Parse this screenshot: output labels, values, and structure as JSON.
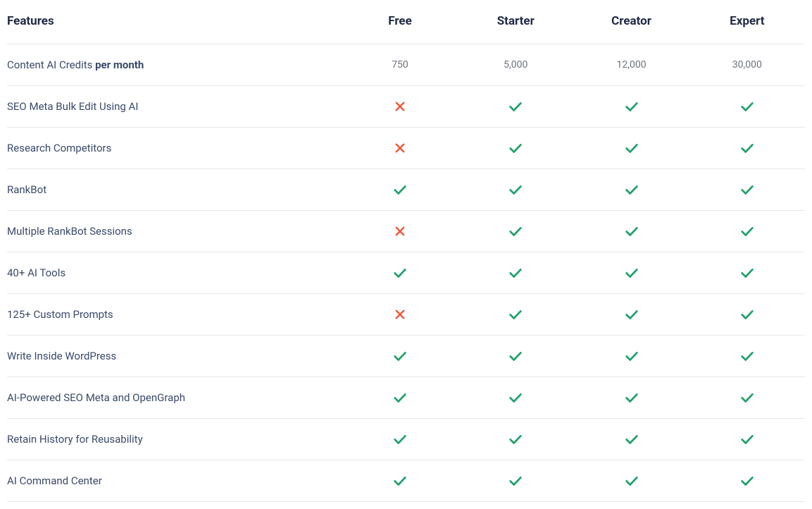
{
  "header": {
    "features_label": "Features",
    "plans": [
      "Free",
      "Starter",
      "Creator",
      "Expert"
    ]
  },
  "rows": [
    {
      "label": "Content AI Credits ",
      "label_bold": "per month",
      "type": "text",
      "values": [
        "750",
        "5,000",
        "12,000",
        "30,000"
      ]
    },
    {
      "label": "SEO Meta Bulk Edit Using AI",
      "type": "bool",
      "values": [
        false,
        true,
        true,
        true
      ]
    },
    {
      "label": "Research Competitors",
      "type": "bool",
      "values": [
        false,
        true,
        true,
        true
      ]
    },
    {
      "label": "RankBot",
      "type": "bool",
      "values": [
        true,
        true,
        true,
        true
      ]
    },
    {
      "label": "Multiple RankBot Sessions",
      "type": "bool",
      "values": [
        false,
        true,
        true,
        true
      ]
    },
    {
      "label": "40+ AI Tools",
      "type": "bool",
      "values": [
        true,
        true,
        true,
        true
      ]
    },
    {
      "label": "125+ Custom Prompts",
      "type": "bool",
      "values": [
        false,
        true,
        true,
        true
      ]
    },
    {
      "label": "Write Inside WordPress",
      "type": "bool",
      "values": [
        true,
        true,
        true,
        true
      ]
    },
    {
      "label": "AI-Powered SEO Meta and OpenGraph",
      "type": "bool",
      "values": [
        true,
        true,
        true,
        true
      ]
    },
    {
      "label": "Retain History for Reusability",
      "type": "bool",
      "values": [
        true,
        true,
        true,
        true
      ]
    },
    {
      "label": "AI Command Center",
      "type": "bool",
      "values": [
        true,
        true,
        true,
        true
      ]
    }
  ],
  "colors": {
    "check": "#22a06b",
    "cross": "#f1563b",
    "border": "#e5e7eb",
    "heading": "#1f2a44",
    "body": "#394a6a"
  },
  "chart_data": {
    "type": "table",
    "title": "Features comparison across plans",
    "columns": [
      "Free",
      "Starter",
      "Creator",
      "Expert"
    ],
    "rows": [
      {
        "feature": "Content AI Credits per month",
        "values": [
          "750",
          "5,000",
          "12,000",
          "30,000"
        ]
      },
      {
        "feature": "SEO Meta Bulk Edit Using AI",
        "values": [
          false,
          true,
          true,
          true
        ]
      },
      {
        "feature": "Research Competitors",
        "values": [
          false,
          true,
          true,
          true
        ]
      },
      {
        "feature": "RankBot",
        "values": [
          true,
          true,
          true,
          true
        ]
      },
      {
        "feature": "Multiple RankBot Sessions",
        "values": [
          false,
          true,
          true,
          true
        ]
      },
      {
        "feature": "40+ AI Tools",
        "values": [
          true,
          true,
          true,
          true
        ]
      },
      {
        "feature": "125+ Custom Prompts",
        "values": [
          false,
          true,
          true,
          true
        ]
      },
      {
        "feature": "Write Inside WordPress",
        "values": [
          true,
          true,
          true,
          true
        ]
      },
      {
        "feature": "AI-Powered SEO Meta and OpenGraph",
        "values": [
          true,
          true,
          true,
          true
        ]
      },
      {
        "feature": "Retain History for Reusability",
        "values": [
          true,
          true,
          true,
          true
        ]
      },
      {
        "feature": "AI Command Center",
        "values": [
          true,
          true,
          true,
          true
        ]
      }
    ]
  }
}
